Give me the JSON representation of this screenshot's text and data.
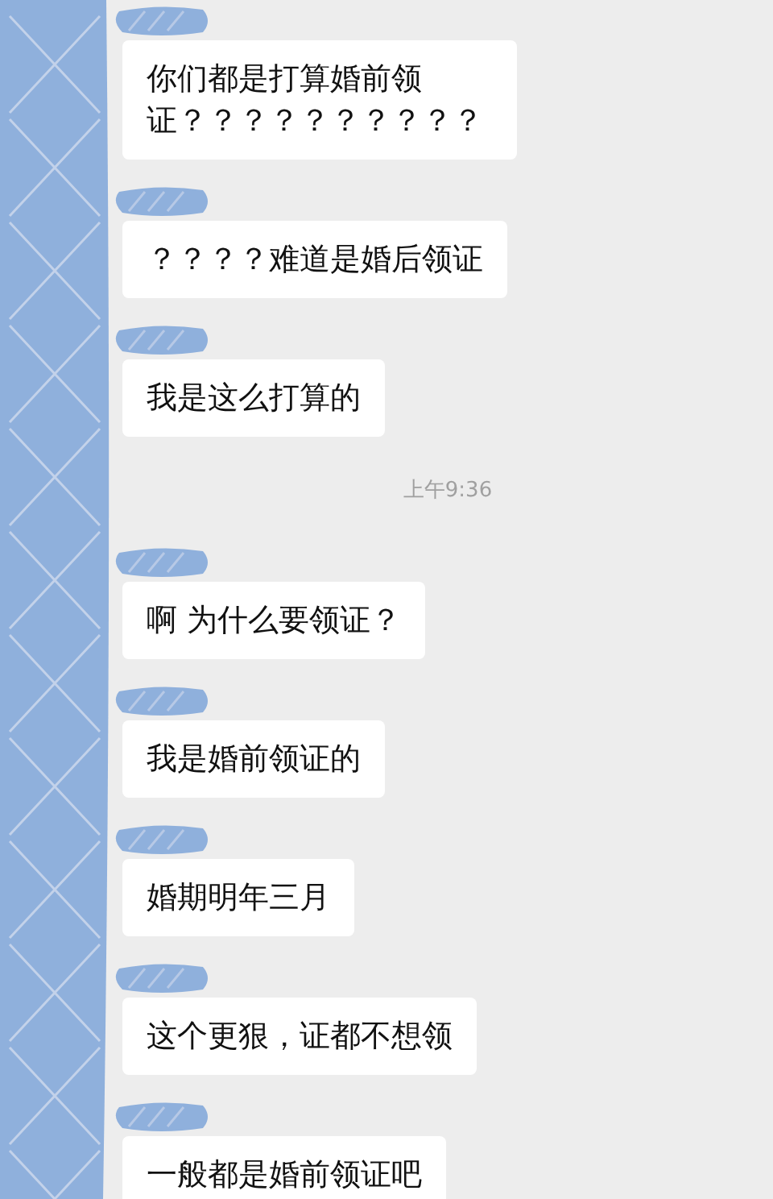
{
  "messages": [
    {
      "kind": "message",
      "text": "你们都是打算婚前领证？？？？？？？？？？"
    },
    {
      "kind": "message",
      "text": "？？？？难道是婚后领证"
    },
    {
      "kind": "message",
      "text": "我是这么打算的"
    },
    {
      "kind": "time",
      "text": "上午9:36"
    },
    {
      "kind": "message",
      "text": "啊 为什么要领证？"
    },
    {
      "kind": "message",
      "text": "我是婚前领证的"
    },
    {
      "kind": "message",
      "text": "婚期明年三月"
    },
    {
      "kind": "message",
      "text": "这个更狠，证都不想领"
    },
    {
      "kind": "message",
      "text": "一般都是婚前领证吧"
    }
  ]
}
